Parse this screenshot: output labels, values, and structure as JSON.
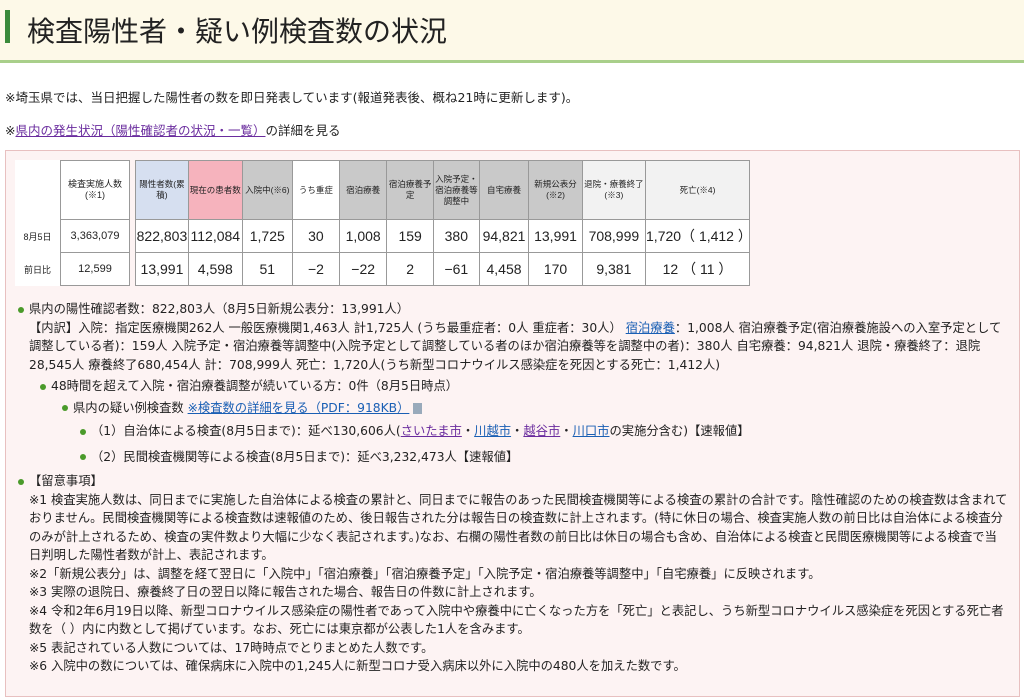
{
  "page": {
    "title": "検査陽性者・疑い例検査数の状況",
    "notice": "※埼玉県では、当日把握した陽性者の数を即日発表しています(報道発表後、概ね21時に更新します)。",
    "detail_prefix": "※",
    "detail_link": "県内の発生状況（陽性確認者の状況・一覧）",
    "detail_suffix": "の詳細を見る"
  },
  "table": {
    "left_header": "検査実施人数(※1)",
    "headers": [
      "陽性者数(累積)",
      "現在の患者数",
      "入院中(※6)",
      "うち重症",
      "宿泊療養",
      "宿泊療養予定",
      "入院予定・宿泊療養等調整中",
      "自宅療養",
      "新規公表分(※2)",
      "退院・療養終了(※3)",
      "死亡(※4)"
    ],
    "rows": [
      {
        "label": "8月5日",
        "tested": "3,363,079",
        "values": [
          "822,803",
          "112,084",
          "1,725",
          "30",
          "1,008",
          "159",
          "380",
          "94,821",
          "13,991",
          "708,999",
          "1,720（ 1,412 ）"
        ]
      },
      {
        "label": "前日比",
        "tested": "12,599",
        "values": [
          "13,991",
          "4,598",
          "51",
          "−2",
          "−22",
          "2",
          "−61",
          "4,458",
          "170",
          "9,381",
          "12 （ 11 ）"
        ]
      }
    ]
  },
  "summary": {
    "line1": "県内の陽性確認者数：822,803人（8月5日新規公表分：13,991人）",
    "breakdown_a": "【内訳】入院：指定医療機関262人 一般医療機関1,463人 計1,725人 (うち最重症者：0人 重症者：30人） ",
    "breakdown_link": "宿泊療養",
    "breakdown_b": "：1,008人 宿泊療養予定(宿泊療養施設への入室予定として調整している者)：159人 入院予定・宿泊療養等調整中(入院予定として調整している者のほか宿泊療養等を調整中の者)：380人 自宅療養：94,821人 退院・療養終了：退院28,545人 療養終了680,454人 計：708,999人 死亡：1,720人(うち新型コロナウイルス感染症を死因とする死亡：1,412人)",
    "line48": "48時間を超えて入院・宿泊療養調整が続いている方：0件（8月5日時点）",
    "suspect_label": "県内の疑い例検査数 ",
    "suspect_link": "※検査数の詳細を見る（PDF：918KB）",
    "local_a": "（1）自治体による検査(8月5日まで)：延べ130,606人(",
    "cities": [
      "さいたま市",
      "川越市",
      "越谷市",
      "川口市"
    ],
    "local_b": "の実施分含む)【速報値】",
    "private": "（2）民間検査機関等による検査(8月5日まで)：延べ3,232,473人【速報値】"
  },
  "notes": {
    "title": "【留意事項】",
    "items": [
      "※1 検査実施人数は、同日までに実施した自治体による検査の累計と、同日までに報告のあった民間検査機関等による検査の累計の合計です。陰性確認のための検査数は含まれておりません。民間検査機関等による検査数は速報値のため、後日報告された分は報告日の検査数に計上されます。(特に休日の場合、検査実施人数の前日比は自治体による検査分のみが計上されるため、検査の実件数より大幅に少なく表記されます。)なお、右欄の陽性者数の前日比は休日の場合も含め、自治体による検査と民間医療機関等による検査で当日判明した陽性者数が計上、表記されます。",
      "※2「新規公表分」は、調整を経て翌日に「入院中」「宿泊療養」「宿泊療養予定」「入院予定・宿泊療養等調整中」「自宅療養」に反映されます。",
      "※3 実際の退院日、療養終了日の翌日以降に報告された場合、報告日の件数に計上されます。",
      "※4 令和2年6月19日以降、新型コロナウイルス感染症の陽性者であって入院中や療養中に亡くなった方を「死亡」と表記し、うち新型コロナウイルス感染症を死因とする死亡者数を（ ）内に内数として掲げています。なお、死亡には東京都が公表した1人を含みます。",
      "※5 表記されている人数については、17時時点でとりまとめた人数です。",
      "※6 入院中の数については、確保病床に入院中の1,245人に新型コロナ受入病床以外に入院中の480人を加えた数です。"
    ]
  },
  "colors": {
    "header_bg": "#fdf9e8",
    "accent_green": "#3a8a3a",
    "box_bg": "#fdf3f3",
    "link": "#1a5fb4"
  }
}
